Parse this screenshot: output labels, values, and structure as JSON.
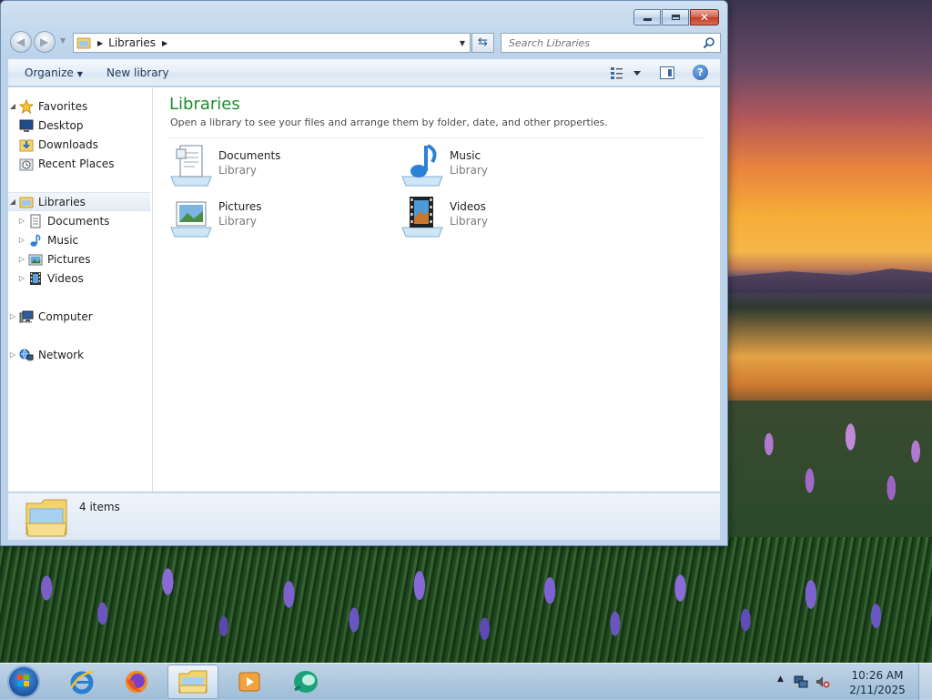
{
  "window": {
    "address": {
      "crumb": "Libraries"
    },
    "search": {
      "placeholder": "Search Libraries"
    },
    "commands": {
      "organize": "Organize",
      "new_library": "New library"
    },
    "nav": {
      "favorites": {
        "label": "Favorites",
        "items": [
          "Desktop",
          "Downloads",
          "Recent Places"
        ]
      },
      "libraries": {
        "label": "Libraries",
        "items": [
          "Documents",
          "Music",
          "Pictures",
          "Videos"
        ]
      },
      "computer": "Computer",
      "network": "Network"
    },
    "content": {
      "title": "Libraries",
      "subtitle": "Open a library to see your files and arrange them by folder, date, and other properties.",
      "libraries": [
        {
          "name": "Documents",
          "type": "Library",
          "icon": "documents-library-icon"
        },
        {
          "name": "Music",
          "type": "Library",
          "icon": "music-library-icon"
        },
        {
          "name": "Pictures",
          "type": "Library",
          "icon": "pictures-library-icon"
        },
        {
          "name": "Videos",
          "type": "Library",
          "icon": "videos-library-icon"
        }
      ]
    },
    "details": {
      "count": "4 items"
    }
  },
  "taskbar": {
    "apps": [
      "internet-explorer-icon",
      "firefox-icon",
      "windows-explorer-icon",
      "media-player-icon",
      "app-icon"
    ],
    "active_app": "windows-explorer-icon",
    "clock": {
      "time": "10:26 AM",
      "date": "2/11/2025"
    }
  },
  "colors": {
    "title_green": "#1e8d2e",
    "close_red": "#c0402a",
    "taskbar": "#a5c3e1"
  }
}
